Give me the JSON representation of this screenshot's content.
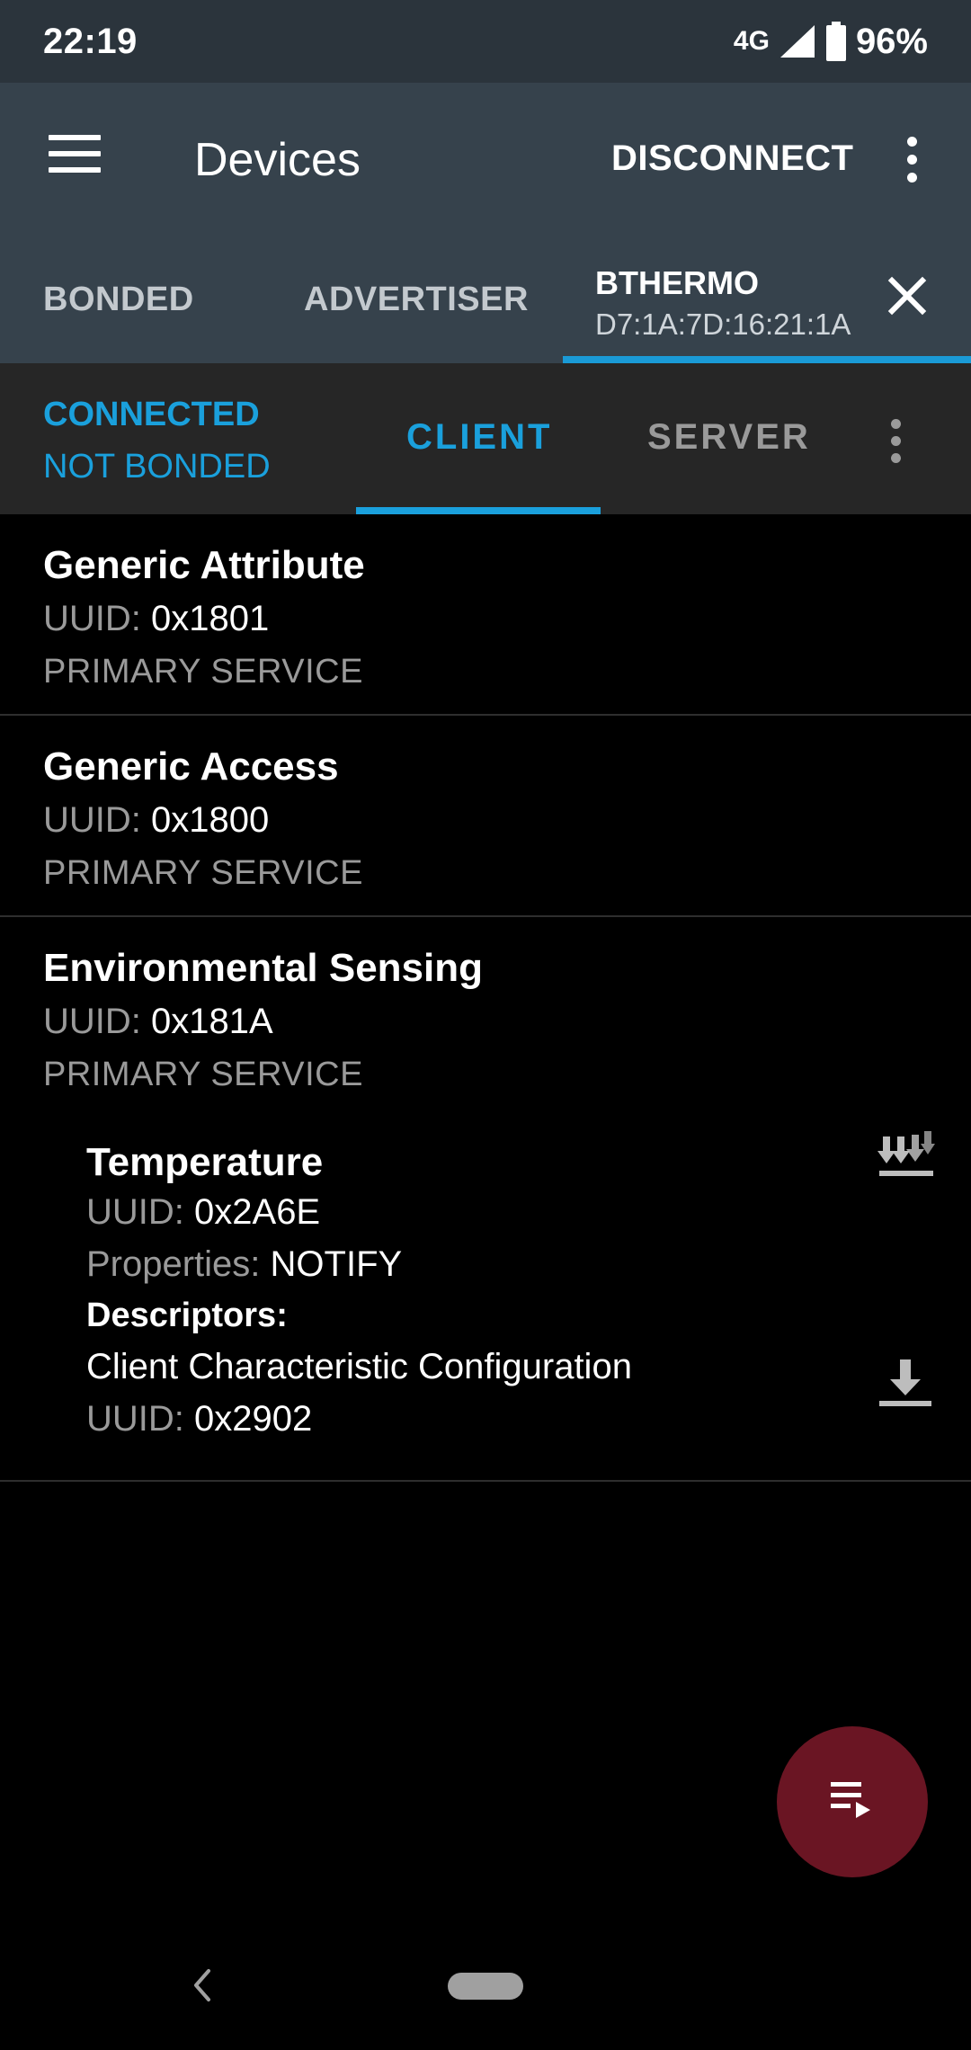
{
  "status_bar": {
    "time": "22:19",
    "network": "4G",
    "battery": "96%"
  },
  "toolbar": {
    "title": "Devices",
    "disconnect_label": "DISCONNECT"
  },
  "device_tabs": {
    "tabs": [
      {
        "label": "BONDED"
      },
      {
        "label": "ADVERTISER"
      }
    ],
    "active": {
      "name": "BTHERMO",
      "address": "D7:1A:7D:16:21:1A"
    }
  },
  "connection": {
    "state": "CONNECTED",
    "bond": "NOT BONDED",
    "tabs": [
      "CLIENT",
      "SERVER"
    ],
    "active_tab": "CLIENT"
  },
  "labels": {
    "uuid": "UUID:",
    "properties": "Properties:",
    "descriptors": "Descriptors:"
  },
  "services": [
    {
      "name": "Generic Attribute",
      "uuid": "0x1801",
      "type": "PRIMARY SERVICE"
    },
    {
      "name": "Generic Access",
      "uuid": "0x1800",
      "type": "PRIMARY SERVICE"
    },
    {
      "name": "Environmental Sensing",
      "uuid": "0x181A",
      "type": "PRIMARY SERVICE",
      "characteristic": {
        "name": "Temperature",
        "uuid": "0x2A6E",
        "properties": "NOTIFY",
        "descriptor": {
          "name": "Client Characteristic Configuration",
          "uuid": "0x2902"
        }
      }
    }
  ],
  "icons": {
    "menu": "hamburger-menu-icon",
    "overflow": "more-vert-icon",
    "close": "close-icon",
    "notify": "notify-arrows-icon",
    "download": "download-icon",
    "fab": "playlist-play-icon",
    "back": "nav-back-icon"
  },
  "colors": {
    "accent": "#1aa0dc",
    "toolbar": "#36424c",
    "fab": "#6a1523"
  }
}
